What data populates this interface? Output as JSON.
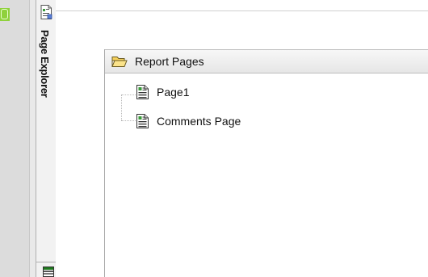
{
  "side_tab": {
    "label": "Page Explorer",
    "icon": "page-explorer-icon"
  },
  "panel": {
    "title": "Report Pages",
    "icon": "folder-open-icon"
  },
  "tree": {
    "items": [
      {
        "label": "Page1",
        "icon": "report-page-icon"
      },
      {
        "label": "Comments Page",
        "icon": "report-page-icon"
      }
    ]
  },
  "colors": {
    "accent_green": "#8fd13c",
    "folder_yellow": "#f6d15c",
    "page_green": "#3a9a3a"
  }
}
